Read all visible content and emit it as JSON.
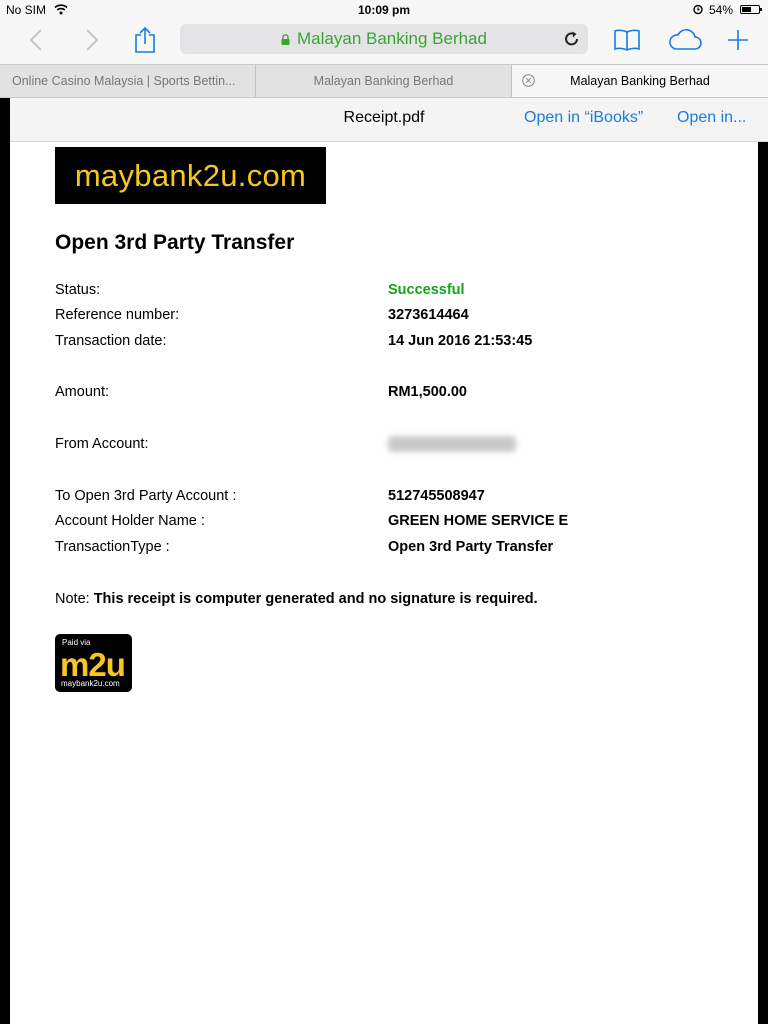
{
  "statusbar": {
    "carrier": "No SIM",
    "time": "10:09 pm",
    "battery": "54%",
    "battery_level": 0.54
  },
  "browser": {
    "url_title": "Malayan Banking Berhad",
    "tabs": [
      {
        "label": "Online Casino Malaysia | Sports Bettin..."
      },
      {
        "label": "Malayan Banking Berhad"
      },
      {
        "label": "Malayan Banking Berhad"
      }
    ]
  },
  "pdf": {
    "filename": "Receipt.pdf",
    "open_in_ibooks": "Open in “iBooks”",
    "open_in": "Open in..."
  },
  "receipt": {
    "logo_text": "maybank2u.com",
    "title": "Open 3rd Party Transfer",
    "status_label": "Status:",
    "status_value": "Successful",
    "status_color": "#16a21a",
    "ref_label": "Reference number:",
    "ref_value": "3273614464",
    "date_label": "Transaction date:",
    "date_value": "14 Jun 2016 21:53:45",
    "amount_label": "Amount:",
    "amount_value": "RM1,500.00",
    "from_label": "From Account:",
    "to_label": "To Open 3rd Party Account :",
    "to_value": "512745508947",
    "holder_label": "Account Holder Name :",
    "holder_value": "GREEN HOME SERVICE E",
    "type_label": "TransactionType :",
    "type_value": "Open 3rd Party Transfer",
    "note_prefix": "Note:",
    "note_text": "This receipt is computer generated and no signature is required.",
    "badge_top": "Paid via",
    "badge_main": "m2u",
    "badge_bottom": "maybank2u.com"
  },
  "colors": {
    "accent_blue": "#1a7ce3",
    "url_green": "#3aa536",
    "brand_yellow": "#f6c81f"
  },
  "icons": [
    "back-icon",
    "forward-icon",
    "share-icon",
    "lock-icon",
    "reload-icon",
    "bookmarks-icon",
    "cloud-tabs-icon",
    "new-tab-icon",
    "tab-close-icon",
    "wifi-icon",
    "alarm-icon",
    "battery-icon"
  ]
}
